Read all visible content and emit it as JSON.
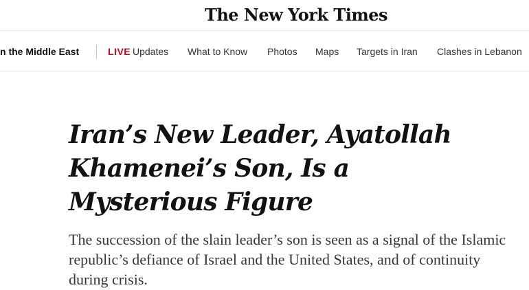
{
  "masthead": {
    "logo_text": "The New York Times"
  },
  "subnav": {
    "section": "n the Middle East",
    "live_badge": "LIVE",
    "items": [
      "Updates",
      "What to Know",
      "Photos",
      "Maps",
      "Targets in Iran",
      "Clashes in Lebanon"
    ]
  },
  "article": {
    "headline": "Iran’s New Leader, Ayatollah Khamenei’s Son, Is a Mysterious Figure",
    "summary": "The succession of the slain leader’s son is seen as a signal of the Islamic republic’s defiance of Israel and the United States, and of continuity during crisis."
  },
  "colors": {
    "live_red": "#d0021b",
    "text": "#121212",
    "rule": "#e2e2e2"
  }
}
